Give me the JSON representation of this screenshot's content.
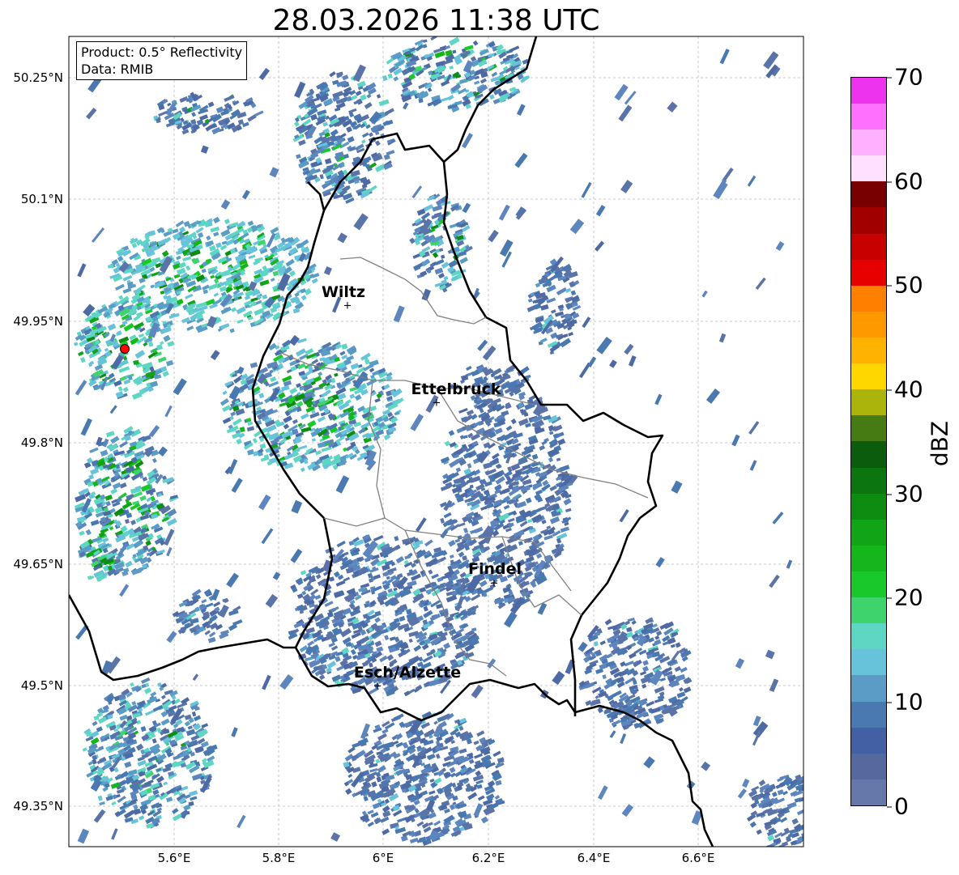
{
  "title": "28.03.2026 11:38 UTC",
  "info": {
    "product": "Product: 0.5° Reflectivity",
    "data": "Data: RMIB"
  },
  "lat_ticks": [
    "50.25°N",
    "50.1°N",
    "49.95°N",
    "49.8°N",
    "49.65°N",
    "49.5°N",
    "49.35°N"
  ],
  "lon_ticks": [
    "5.6°E",
    "5.8°E",
    "6°E",
    "6.2°E",
    "6.4°E",
    "6.6°E"
  ],
  "cities": [
    {
      "name": "Wiltz"
    },
    {
      "name": "Ettelbruck"
    },
    {
      "name": "Findel"
    },
    {
      "name": "Esch/Alzette"
    }
  ],
  "colorbar": {
    "label": "dBZ",
    "ticks": [
      "0",
      "10",
      "20",
      "30",
      "40",
      "50",
      "60",
      "70"
    ],
    "colors": [
      "#6677aa",
      "#55699f",
      "#4460a5",
      "#4a78b0",
      "#5a9cc6",
      "#66c3da",
      "#5ed6c4",
      "#3ed36c",
      "#19c829",
      "#14b61b",
      "#11a416",
      "#0e8c12",
      "#0d7510",
      "#0b5c0d",
      "#467a12",
      "#aab40a",
      "#ffd700",
      "#ffb300",
      "#ff9900",
      "#ff7f00",
      "#e60000",
      "#c80000",
      "#a00000",
      "#780000",
      "#ffe0ff",
      "#ffb0ff",
      "#ff70ff",
      "#ee33ee"
    ]
  }
}
